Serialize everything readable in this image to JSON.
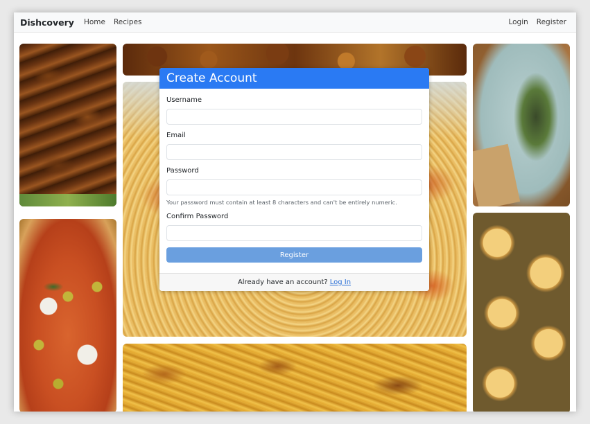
{
  "navbar": {
    "brand": "Dishcovery",
    "links_left": [
      "Home",
      "Recipes"
    ],
    "links_right": [
      "Login",
      "Register"
    ]
  },
  "modal": {
    "title": "Create Account",
    "fields": {
      "username_label": "Username",
      "username_value": "",
      "email_label": "Email",
      "email_value": "",
      "password_label": "Password",
      "password_value": "",
      "password_help": "Your password must contain at least 8 characters and can't be entirely numeric.",
      "confirm_label": "Confirm Password",
      "confirm_value": ""
    },
    "submit_label": "Register",
    "footer_text": "Already have an account?",
    "footer_link": "Log In"
  },
  "colors": {
    "header_blue": "#2a7af3",
    "button_blue": "#6a9fdf",
    "link_blue": "#2a6fd6"
  },
  "background_images": [
    "chicken-skewers",
    "pizza",
    "fried-dish",
    "spaghetti",
    "paella",
    "tacos",
    "pani-puri"
  ]
}
